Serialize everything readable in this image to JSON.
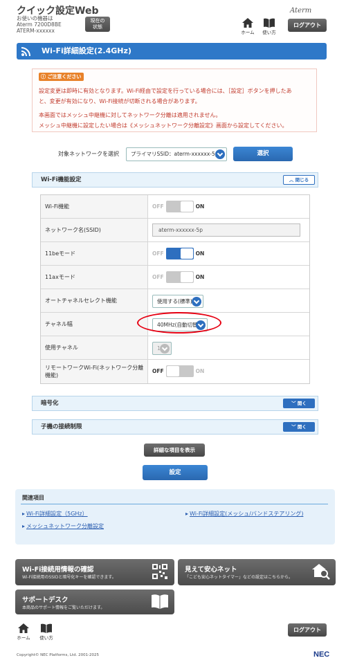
{
  "header": {
    "app_title": "クイック設定Web",
    "model_line1": "お使いの機器は",
    "model_line2": "Aterm 7200D8BE",
    "model_line3": "ATERM-xxxxxx",
    "status_button_line1": "現在の",
    "status_button_line2": "状態",
    "home_label": "ホーム",
    "help_label": "使い方",
    "brand": "Aterm",
    "logout_label": "ログアウト"
  },
  "page": {
    "title": "Wi-Fi詳細設定(2.4GHz)"
  },
  "notice": {
    "badge": "ご注意ください",
    "line1": "設定変更は即時に有効となります。Wi-Fi経由で設定を行っている場合には、［設定］ボタンを押したあ",
    "line2": "と、変更が有効になり、Wi-Fi接続が切断される場合があります。",
    "line3": "本画面ではメッシュ中継機に対してネットワーク分離は適用されません。",
    "line4": "メッシュ中継機に設定したい場合は《メッシュネットワーク分離設定》画面から設定してください。"
  },
  "network_select": {
    "label": "対象ネットワークを選択",
    "selected": "プライマリSSID：aterm-xxxxxx-5p",
    "button": "選択"
  },
  "wifi_function_section": {
    "title": "Wi-Fi機能設定",
    "toggle_label": "閉じる",
    "off_text": "OFF",
    "on_text": "ON",
    "rows": {
      "wifi": {
        "label": "Wi-Fi機能",
        "state": "off"
      },
      "ssid": {
        "label": "ネットワーク名(SSID)",
        "value": "aterm-xxxxxx-5p"
      },
      "be11": {
        "label": "11beモード",
        "state": "on"
      },
      "ax11": {
        "label": "11axモード",
        "state": "off"
      },
      "auto_channel": {
        "label": "オートチャネルセレクト機能",
        "selected": "使用する(標準)"
      },
      "channel_width": {
        "label": "チャネル幅",
        "selected": "40MHz(自動切替)"
      },
      "channel": {
        "label": "使用チャネル",
        "selected": "1"
      },
      "remote_work": {
        "label_line1": "リモートワークWi-Fi(ネットワーク分離",
        "label_line2": "機能)",
        "state": "off"
      }
    }
  },
  "encryption_section": {
    "title": "暗号化",
    "toggle_label": "開く"
  },
  "client_limit_section": {
    "title": "子機の接続制限",
    "toggle_label": "開く"
  },
  "buttons": {
    "show_details": "詳細な項目を表示",
    "apply": "設定"
  },
  "related": {
    "title": "関連項目",
    "links": [
      "Wi-Fi詳細設定（5GHz）",
      "Wi-Fi詳細設定(メッシュ/バンドステアリング)",
      "メッシュネットワーク分離設定"
    ]
  },
  "banners": {
    "connection_info": {
      "title": "Wi-Fi接続用情報の確認",
      "subtitle": "Wi-Fi接続用のSSIDと暗号化キーを確認できます。"
    },
    "safe_net": {
      "title": "見えて安心ネット",
      "subtitle": "「こども安心ネットタイマー」などの設定はこちらから。"
    },
    "support": {
      "title": "サポートデスク",
      "subtitle": "本商品のサポート情報をご覧いただけます。"
    }
  },
  "footer": {
    "copyright": "Copyright© NEC Platforms, Ltd. 2001-2025",
    "logo": "NEC"
  },
  "colors": {
    "accent": "#2e78c8",
    "switch_on": "#2e6fbf",
    "switch_off": "#c8c8c8",
    "notice_text": "#c0392b",
    "annotation": "#e60012"
  }
}
